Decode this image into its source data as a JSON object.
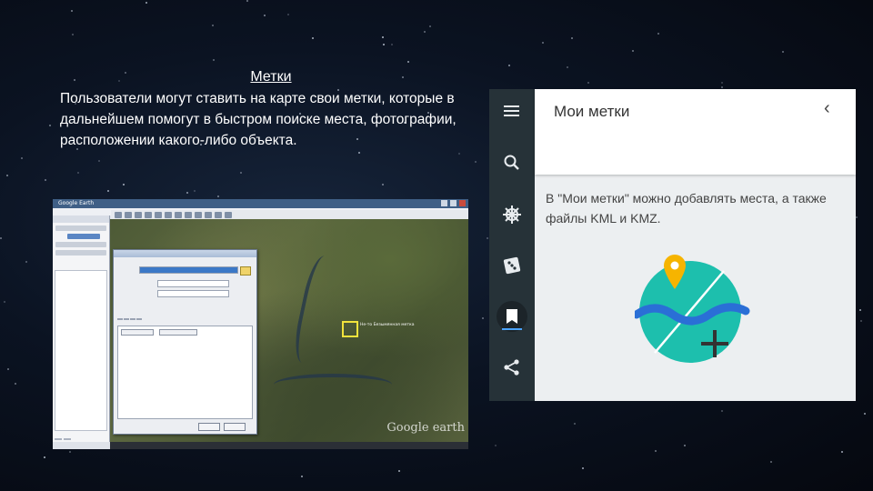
{
  "slide": {
    "title": "Метки",
    "body": "Пользователи могут ставить на карте свои метки, которые в дальнейшем помогут в быстром поиске места, фотографии, расположении какого-либо объекта."
  },
  "google_earth": {
    "window_title": "Google Earth",
    "map_target_label": "Не-то Безымянная метка",
    "logo": "Google earth"
  },
  "maps_panel": {
    "title": "Мои метки",
    "back_icon": "chevron-left-icon",
    "info_text": "В \"Мои метки\" можно добавлять места, а также файлы KML и KMZ.",
    "rail_icons": [
      "menu-icon",
      "search-icon",
      "ship-wheel-icon",
      "dice-icon",
      "bookmark-icon",
      "share-icon"
    ],
    "active_icon": "bookmark-icon",
    "colors": {
      "rail": "#263238",
      "panel_bg": "#eceff1",
      "teal": "#1dbfad",
      "wave": "#2a6fd6",
      "pin": "#f6b400"
    }
  }
}
